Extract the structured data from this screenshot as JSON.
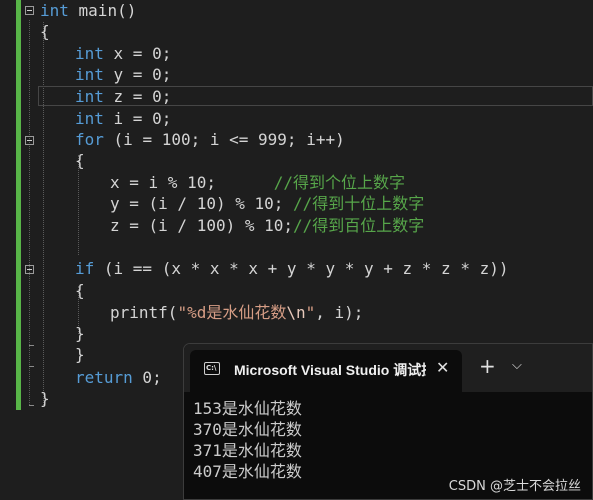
{
  "editor": {
    "lines": [
      {
        "segments": [
          {
            "t": "int",
            "c": "kw"
          },
          {
            "t": " main()"
          }
        ]
      },
      {
        "segments": [
          {
            "t": "{"
          }
        ]
      },
      {
        "segments": [
          {
            "t": "int",
            "c": "kw"
          },
          {
            "t": " x = 0;"
          }
        ]
      },
      {
        "segments": [
          {
            "t": "int",
            "c": "kw"
          },
          {
            "t": " y = 0;"
          }
        ]
      },
      {
        "segments": [
          {
            "t": "int",
            "c": "kw"
          },
          {
            "t": " z = 0;"
          }
        ]
      },
      {
        "segments": [
          {
            "t": "int",
            "c": "kw"
          },
          {
            "t": " i = 0;"
          }
        ]
      },
      {
        "segments": [
          {
            "t": "for",
            "c": "kw"
          },
          {
            "t": " (i = 100; i <= 999; i++)"
          }
        ]
      },
      {
        "segments": [
          {
            "t": "{"
          }
        ]
      },
      {
        "segments": [
          {
            "t": "x = i % 10;      "
          },
          {
            "t": "//得到个位上数字",
            "c": "cm"
          }
        ]
      },
      {
        "segments": [
          {
            "t": "y = (i / 10) % 10; "
          },
          {
            "t": "//得到十位上数字",
            "c": "cm"
          }
        ]
      },
      {
        "segments": [
          {
            "t": "z = (i / 100) % 10;"
          },
          {
            "t": "//得到百位上数字",
            "c": "cm"
          }
        ]
      },
      {
        "segments": [
          {
            "t": ""
          }
        ]
      },
      {
        "segments": [
          {
            "t": "if",
            "c": "kw"
          },
          {
            "t": " (i == (x * x * x + y * y * y + z * z * z))"
          }
        ]
      },
      {
        "segments": [
          {
            "t": "{"
          }
        ]
      },
      {
        "segments": [
          {
            "t": "printf("
          },
          {
            "t": "\"%d是水仙花数",
            "c": "st"
          },
          {
            "t": "\\n",
            "c": "esc"
          },
          {
            "t": "\"",
            "c": "st"
          },
          {
            "t": ", i);"
          }
        ]
      },
      {
        "segments": [
          {
            "t": "}"
          }
        ]
      },
      {
        "segments": [
          {
            "t": "}"
          }
        ]
      },
      {
        "segments": [
          {
            "t": "return",
            "c": "kw"
          },
          {
            "t": " 0;"
          }
        ]
      },
      {
        "segments": [
          {
            "t": "}"
          }
        ]
      }
    ]
  },
  "terminal": {
    "tab_icon_text": "C:\\",
    "tab_title": "Microsoft Visual Studio 调试控制台",
    "close_glyph": "✕",
    "new_tab_glyph": "+",
    "dropdown_glyph": "⌵",
    "output": [
      "153是水仙花数",
      "370是水仙花数",
      "371是水仙花数",
      "407是水仙花数"
    ]
  },
  "watermark": "CSDN @芝士不会拉丝",
  "colors": {
    "editor_bg": "#1e1e1e",
    "keyword": "#569cd6",
    "comment": "#57a64a",
    "string": "#d69d85",
    "change_bar": "#58b548",
    "terminal_bg": "#0c0c0c"
  }
}
